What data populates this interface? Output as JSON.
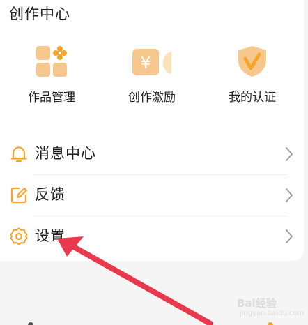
{
  "section": {
    "title": "创作中心"
  },
  "tiles": [
    {
      "label": "作品管理",
      "icon": "works-grid-icon"
    },
    {
      "label": "创作激励",
      "icon": "yuan-coin-icon"
    },
    {
      "label": "我的认证",
      "icon": "verified-shield-icon"
    }
  ],
  "menu": [
    {
      "label": "消息中心",
      "icon": "bell-icon"
    },
    {
      "label": "反馈",
      "icon": "edit-icon"
    },
    {
      "label": "设置",
      "icon": "gear-icon"
    }
  ],
  "watermark": {
    "text": "Bai经验",
    "url": "jingyan.baidu.com"
  },
  "colors": {
    "accent": "#f5a52a",
    "accent_light": "#fbe2bc",
    "annotation": "#e8394d"
  }
}
